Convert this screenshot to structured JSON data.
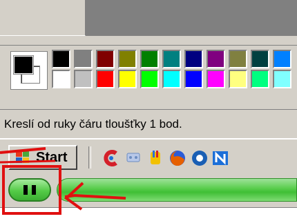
{
  "status_bar": {
    "text": "Kreslí od ruky čáru tloušťky 1 bod."
  },
  "taskbar": {
    "start_label": "Start",
    "quick_launch": [
      {
        "icon": "ccleaner-icon",
        "color": "#d4202a"
      },
      {
        "icon": "network-icon",
        "color": "#6c8cc0"
      },
      {
        "icon": "paint-icon",
        "color": "#d6a000"
      },
      {
        "icon": "firefox-icon",
        "color": "#e66000"
      },
      {
        "icon": "circle-app-icon",
        "color": "#1a5fb4"
      },
      {
        "icon": "n-app-icon",
        "color": "#1c6fd8"
      }
    ]
  },
  "palette": {
    "foreground": "#000000",
    "background": "#ffffff",
    "top_row": [
      "#000000",
      "#808080",
      "#800000",
      "#808000",
      "#008000",
      "#008080",
      "#000080",
      "#800080",
      "#808040",
      "#004040",
      "#0080ff"
    ],
    "bottom_row": [
      "#ffffff",
      "#c0c0c0",
      "#ff0000",
      "#ffff00",
      "#00ff00",
      "#00ffff",
      "#0000ff",
      "#ff00ff",
      "#ffff80",
      "#00ff80",
      "#80ffff"
    ]
  },
  "annotation": {
    "color": "#e01010"
  }
}
